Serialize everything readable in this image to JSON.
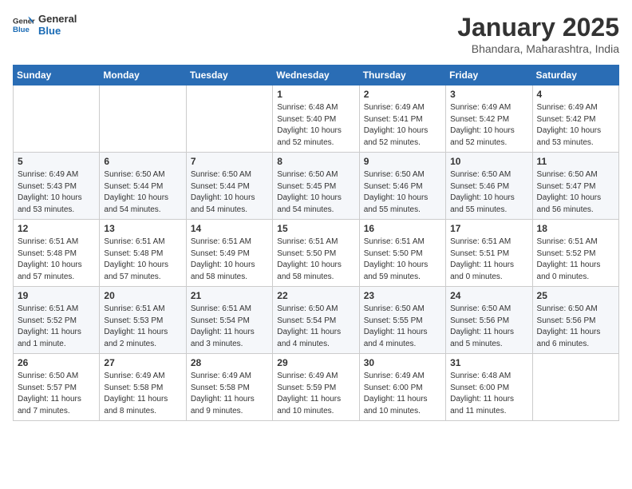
{
  "header": {
    "logo_line1": "General",
    "logo_line2": "Blue",
    "month_year": "January 2025",
    "location": "Bhandara, Maharashtra, India"
  },
  "weekdays": [
    "Sunday",
    "Monday",
    "Tuesday",
    "Wednesday",
    "Thursday",
    "Friday",
    "Saturday"
  ],
  "weeks": [
    [
      {
        "day": "",
        "sunrise": "",
        "sunset": "",
        "daylight": ""
      },
      {
        "day": "",
        "sunrise": "",
        "sunset": "",
        "daylight": ""
      },
      {
        "day": "",
        "sunrise": "",
        "sunset": "",
        "daylight": ""
      },
      {
        "day": "1",
        "sunrise": "Sunrise: 6:48 AM",
        "sunset": "Sunset: 5:40 PM",
        "daylight": "Daylight: 10 hours and 52 minutes."
      },
      {
        "day": "2",
        "sunrise": "Sunrise: 6:49 AM",
        "sunset": "Sunset: 5:41 PM",
        "daylight": "Daylight: 10 hours and 52 minutes."
      },
      {
        "day": "3",
        "sunrise": "Sunrise: 6:49 AM",
        "sunset": "Sunset: 5:42 PM",
        "daylight": "Daylight: 10 hours and 52 minutes."
      },
      {
        "day": "4",
        "sunrise": "Sunrise: 6:49 AM",
        "sunset": "Sunset: 5:42 PM",
        "daylight": "Daylight: 10 hours and 53 minutes."
      }
    ],
    [
      {
        "day": "5",
        "sunrise": "Sunrise: 6:49 AM",
        "sunset": "Sunset: 5:43 PM",
        "daylight": "Daylight: 10 hours and 53 minutes."
      },
      {
        "day": "6",
        "sunrise": "Sunrise: 6:50 AM",
        "sunset": "Sunset: 5:44 PM",
        "daylight": "Daylight: 10 hours and 54 minutes."
      },
      {
        "day": "7",
        "sunrise": "Sunrise: 6:50 AM",
        "sunset": "Sunset: 5:44 PM",
        "daylight": "Daylight: 10 hours and 54 minutes."
      },
      {
        "day": "8",
        "sunrise": "Sunrise: 6:50 AM",
        "sunset": "Sunset: 5:45 PM",
        "daylight": "Daylight: 10 hours and 54 minutes."
      },
      {
        "day": "9",
        "sunrise": "Sunrise: 6:50 AM",
        "sunset": "Sunset: 5:46 PM",
        "daylight": "Daylight: 10 hours and 55 minutes."
      },
      {
        "day": "10",
        "sunrise": "Sunrise: 6:50 AM",
        "sunset": "Sunset: 5:46 PM",
        "daylight": "Daylight: 10 hours and 55 minutes."
      },
      {
        "day": "11",
        "sunrise": "Sunrise: 6:50 AM",
        "sunset": "Sunset: 5:47 PM",
        "daylight": "Daylight: 10 hours and 56 minutes."
      }
    ],
    [
      {
        "day": "12",
        "sunrise": "Sunrise: 6:51 AM",
        "sunset": "Sunset: 5:48 PM",
        "daylight": "Daylight: 10 hours and 57 minutes."
      },
      {
        "day": "13",
        "sunrise": "Sunrise: 6:51 AM",
        "sunset": "Sunset: 5:48 PM",
        "daylight": "Daylight: 10 hours and 57 minutes."
      },
      {
        "day": "14",
        "sunrise": "Sunrise: 6:51 AM",
        "sunset": "Sunset: 5:49 PM",
        "daylight": "Daylight: 10 hours and 58 minutes."
      },
      {
        "day": "15",
        "sunrise": "Sunrise: 6:51 AM",
        "sunset": "Sunset: 5:50 PM",
        "daylight": "Daylight: 10 hours and 58 minutes."
      },
      {
        "day": "16",
        "sunrise": "Sunrise: 6:51 AM",
        "sunset": "Sunset: 5:50 PM",
        "daylight": "Daylight: 10 hours and 59 minutes."
      },
      {
        "day": "17",
        "sunrise": "Sunrise: 6:51 AM",
        "sunset": "Sunset: 5:51 PM",
        "daylight": "Daylight: 11 hours and 0 minutes."
      },
      {
        "day": "18",
        "sunrise": "Sunrise: 6:51 AM",
        "sunset": "Sunset: 5:52 PM",
        "daylight": "Daylight: 11 hours and 0 minutes."
      }
    ],
    [
      {
        "day": "19",
        "sunrise": "Sunrise: 6:51 AM",
        "sunset": "Sunset: 5:52 PM",
        "daylight": "Daylight: 11 hours and 1 minute."
      },
      {
        "day": "20",
        "sunrise": "Sunrise: 6:51 AM",
        "sunset": "Sunset: 5:53 PM",
        "daylight": "Daylight: 11 hours and 2 minutes."
      },
      {
        "day": "21",
        "sunrise": "Sunrise: 6:51 AM",
        "sunset": "Sunset: 5:54 PM",
        "daylight": "Daylight: 11 hours and 3 minutes."
      },
      {
        "day": "22",
        "sunrise": "Sunrise: 6:50 AM",
        "sunset": "Sunset: 5:54 PM",
        "daylight": "Daylight: 11 hours and 4 minutes."
      },
      {
        "day": "23",
        "sunrise": "Sunrise: 6:50 AM",
        "sunset": "Sunset: 5:55 PM",
        "daylight": "Daylight: 11 hours and 4 minutes."
      },
      {
        "day": "24",
        "sunrise": "Sunrise: 6:50 AM",
        "sunset": "Sunset: 5:56 PM",
        "daylight": "Daylight: 11 hours and 5 minutes."
      },
      {
        "day": "25",
        "sunrise": "Sunrise: 6:50 AM",
        "sunset": "Sunset: 5:56 PM",
        "daylight": "Daylight: 11 hours and 6 minutes."
      }
    ],
    [
      {
        "day": "26",
        "sunrise": "Sunrise: 6:50 AM",
        "sunset": "Sunset: 5:57 PM",
        "daylight": "Daylight: 11 hours and 7 minutes."
      },
      {
        "day": "27",
        "sunrise": "Sunrise: 6:49 AM",
        "sunset": "Sunset: 5:58 PM",
        "daylight": "Daylight: 11 hours and 8 minutes."
      },
      {
        "day": "28",
        "sunrise": "Sunrise: 6:49 AM",
        "sunset": "Sunset: 5:58 PM",
        "daylight": "Daylight: 11 hours and 9 minutes."
      },
      {
        "day": "29",
        "sunrise": "Sunrise: 6:49 AM",
        "sunset": "Sunset: 5:59 PM",
        "daylight": "Daylight: 11 hours and 10 minutes."
      },
      {
        "day": "30",
        "sunrise": "Sunrise: 6:49 AM",
        "sunset": "Sunset: 6:00 PM",
        "daylight": "Daylight: 11 hours and 10 minutes."
      },
      {
        "day": "31",
        "sunrise": "Sunrise: 6:48 AM",
        "sunset": "Sunset: 6:00 PM",
        "daylight": "Daylight: 11 hours and 11 minutes."
      },
      {
        "day": "",
        "sunrise": "",
        "sunset": "",
        "daylight": ""
      }
    ]
  ]
}
